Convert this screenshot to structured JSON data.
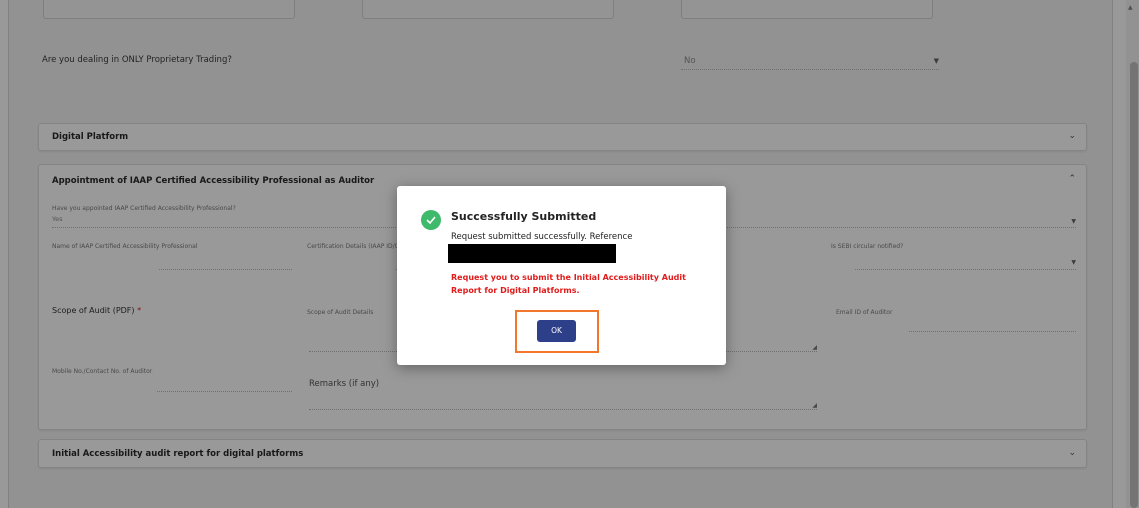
{
  "form": {
    "proprietary_question": "Are you dealing in ONLY Proprietary Trading?",
    "proprietary_value": "No",
    "sections": {
      "digital_platform": "Digital Platform",
      "appointment": "Appointment of IAAP Certified Accessibility Professional as Auditor",
      "initial_audit": "Initial Accessibility audit report for digital platforms"
    },
    "appointment_fields": {
      "appointed_question": "Have you appointed IAAP Certified Accessibility Professional?",
      "appointed_value": "Yes",
      "name_label": "Name of IAAP Certified Accessibility Professional",
      "cert_label": "Certification Details (IAAP ID/C",
      "sebi_label": "Is SEBI circular notified?",
      "scope_pdf_label": "Scope of Audit (PDF)",
      "required_mark": "*",
      "scope_details_label": "Scope of Audit Details",
      "email_label": "Email ID of Auditor",
      "mobile_label": "Mobile No./Contact No. of Auditor",
      "remarks_label": "Remarks (if any)"
    }
  },
  "modal": {
    "title": "Successfully Submitted",
    "message": "Request submitted successfully. Reference",
    "warning": "Request you to submit the Initial Accessibility Audit Report for Digital Platforms.",
    "ok_label": "OK"
  },
  "icons": {
    "dropdown": "caret-down-icon",
    "collapse": "chevron-up-icon",
    "expand": "chevron-down-icon",
    "success": "check-circle-icon"
  },
  "colors": {
    "success": "#3fb96c",
    "warning_text": "#e21b1b",
    "ok_button": "#2e3f8a",
    "highlight": "#f2772c"
  }
}
